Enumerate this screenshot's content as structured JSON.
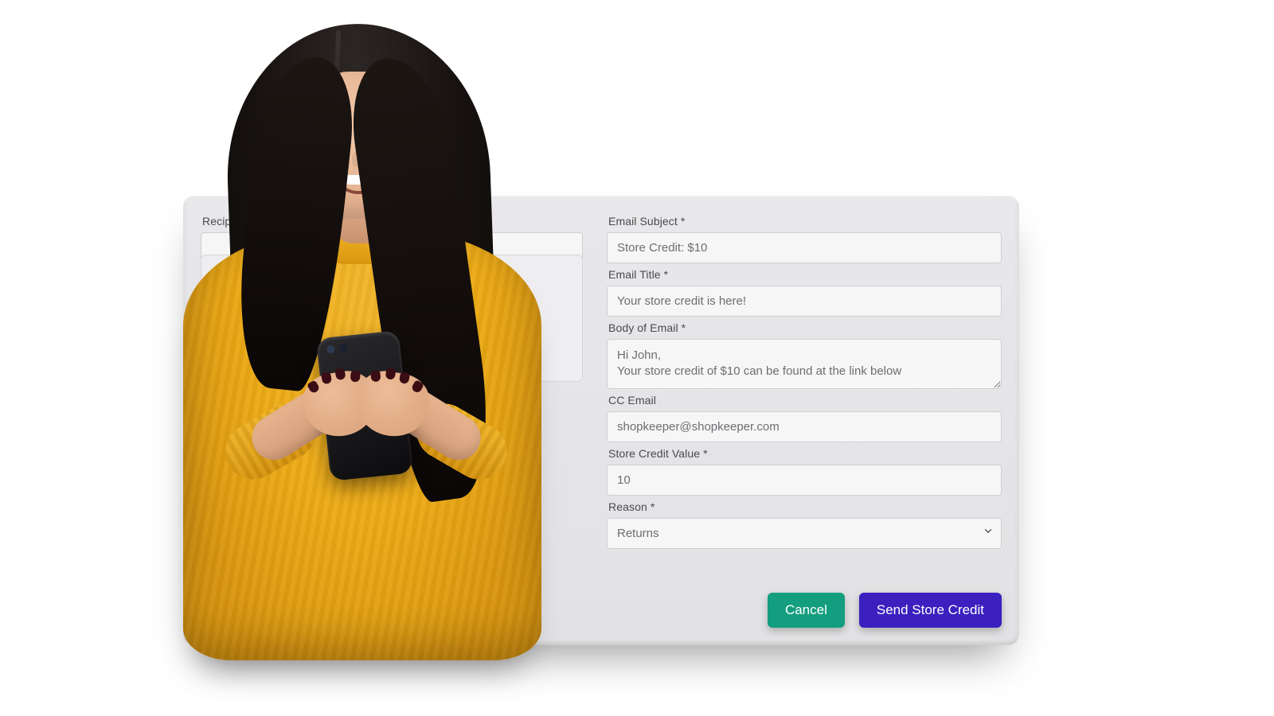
{
  "left": {
    "recipient_label": "Recipient Name"
  },
  "right": {
    "subject_label": "Email Subject *",
    "subject_value": "Store Credit: $10",
    "title_label": "Email Title *",
    "title_value": "Your store credit is here!",
    "body_label": "Body of Email *",
    "body_value": "Hi John,\nYour store credit of $10 can be found at the link below",
    "cc_label": "CC Email",
    "cc_value": "shopkeeper@shopkeeper.com",
    "value_label": "Store Credit Value *",
    "value_value": "10",
    "reason_label": "Reason *",
    "reason_value": "Returns"
  },
  "buttons": {
    "cancel": "Cancel",
    "send": "Send Store Credit"
  },
  "colors": {
    "cancel_bg": "#139e7f",
    "send_bg": "#3b1fbf"
  }
}
